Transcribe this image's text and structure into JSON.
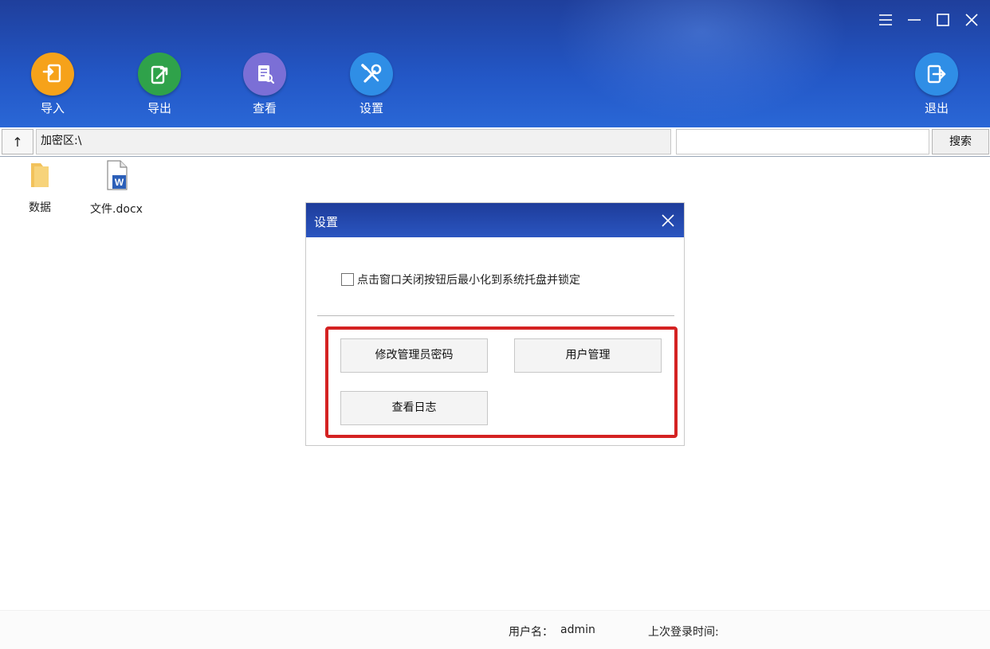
{
  "window": {
    "controls": [
      {
        "name": "menu-icon"
      },
      {
        "name": "minimize-icon"
      },
      {
        "name": "maximize-icon"
      },
      {
        "name": "close-icon"
      }
    ]
  },
  "toolbar": {
    "import_label": "导入",
    "export_label": "导出",
    "view_label": "查看",
    "settings_label": "设置",
    "logout_label": "退出",
    "colors": {
      "import": "#f6a21a",
      "export": "#2fa24a",
      "view": "#7b6fd6",
      "settings": "#2f8ee6",
      "logout": "#2f8ee6"
    },
    "icons": {
      "import": "import-icon",
      "export": "export-icon",
      "view": "document-view-icon",
      "settings": "wrench-screwdriver-icon",
      "logout": "logout-icon"
    }
  },
  "pathbar": {
    "up_label": "↑",
    "path": "加密区:\\",
    "search_value": "",
    "search_label": "搜索"
  },
  "files": [
    {
      "name": "数据",
      "icon": "folder-icon"
    },
    {
      "name": "文件.docx",
      "icon": "word-document-icon"
    }
  ],
  "dialog": {
    "title": "设置",
    "checkbox_label": "点击窗口关闭按钮后最小化到系统托盘并锁定",
    "checkbox_checked": false,
    "buttons": {
      "change_admin_password": "修改管理员密码",
      "user_management": "用户管理",
      "view_log": "查看日志"
    },
    "highlight_color": "#d42222"
  },
  "status": {
    "username_label": "用户名：",
    "username": "admin",
    "last_login_label": "上次登录时间:"
  }
}
